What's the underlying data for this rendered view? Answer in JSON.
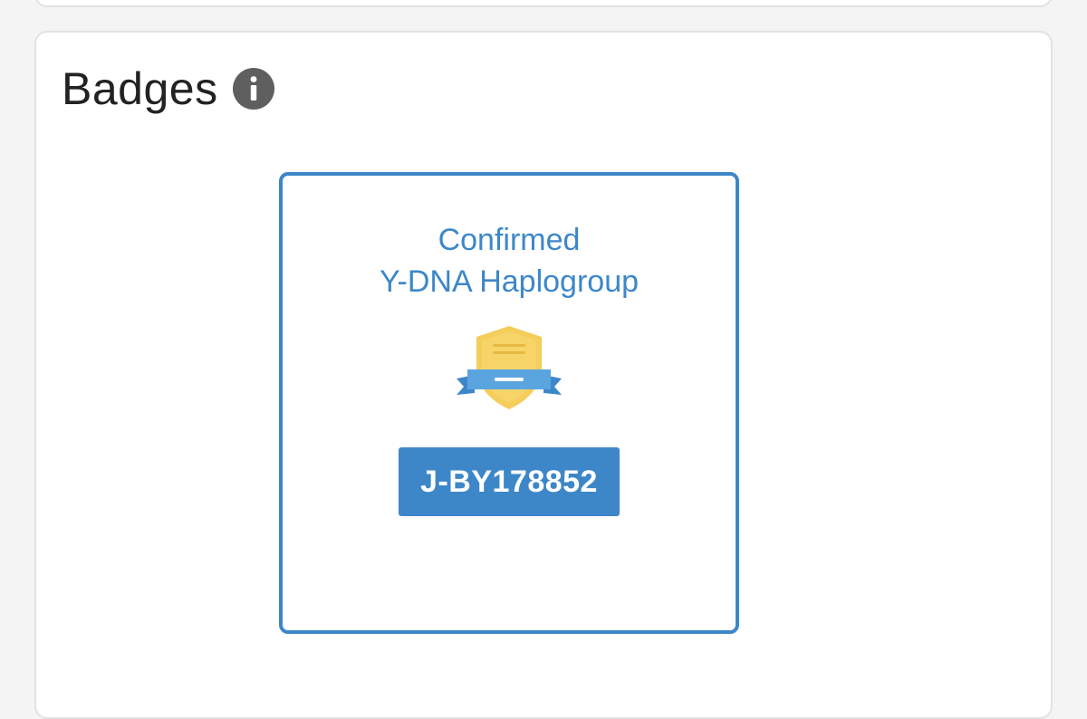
{
  "section": {
    "title": "Badges",
    "info_icon": "info-icon"
  },
  "badge": {
    "title_line1": "Confirmed",
    "title_line2": "Y-DNA Haplogroup",
    "icon": "shield-ribbon-icon",
    "haplogroup": "J-BY178852"
  },
  "colors": {
    "accent": "#3d87c9",
    "shield_gold": "#f5cd5a",
    "text_dark": "#222222",
    "icon_gray": "#5f5f5f",
    "card_border": "#e2e2e2"
  }
}
